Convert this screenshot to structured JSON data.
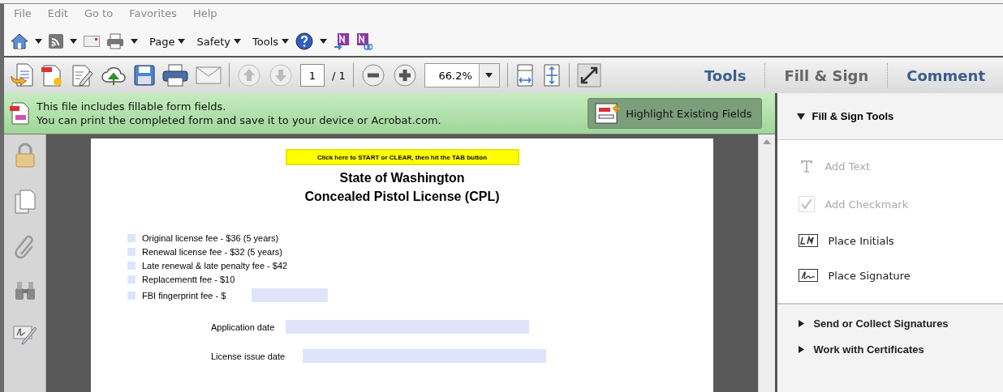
{
  "menu_bar": [
    "File",
    "Edit",
    "Go to",
    "Favorites",
    "Help"
  ],
  "browser_toolbar": {
    "menus": [
      "Page",
      "Safety",
      "Tools"
    ]
  },
  "toolbar": {
    "page_number": "1",
    "page_count": "/ 1",
    "zoom": "66.2%"
  },
  "tabs": [
    {
      "label": "Tools",
      "selected": false
    },
    {
      "label": "Fill & Sign",
      "selected": true
    },
    {
      "label": "Comment",
      "selected": false
    }
  ],
  "notification": {
    "lines": [
      "This file includes fillable form fields.",
      "You can print the completed form and save it to your device or Acrobat.com."
    ],
    "button": "Highlight Existing Fields"
  },
  "document": {
    "start_button": "Click here to START or CLEAR, then hit the TAB button",
    "title": [
      "State of Washington",
      "Concealed Pistol License (CPL)"
    ],
    "fees": [
      {
        "label": "Original license fee - $36 (5 years)",
        "checked": false
      },
      {
        "label": "Renewal license fee - $32 (5 years)",
        "checked": false
      },
      {
        "label": "Late renewal & late penalty fee - $42",
        "checked": false
      },
      {
        "label": "Replacementt fee - $10",
        "checked": false
      },
      {
        "label": "FBI fingerprint fee - $",
        "checked": false,
        "has_field": true
      }
    ],
    "dates": [
      {
        "label": "Application date"
      },
      {
        "label": "License issue date"
      }
    ]
  },
  "right_pane": {
    "section": {
      "title": "Fill & Sign Tools",
      "expanded": true
    },
    "tools": [
      {
        "kind": "text",
        "label": "Add Text",
        "disabled": true
      },
      {
        "kind": "checkmark",
        "label": "Add Checkmark",
        "disabled": true
      },
      {
        "kind": "initials",
        "label": "Place Initials",
        "disabled": false
      },
      {
        "kind": "signature",
        "label": "Place Signature",
        "disabled": false
      }
    ],
    "groups": [
      {
        "title": "Send or Collect Signatures",
        "expanded": false
      },
      {
        "title": "Work with Certificates",
        "expanded": false
      }
    ]
  }
}
